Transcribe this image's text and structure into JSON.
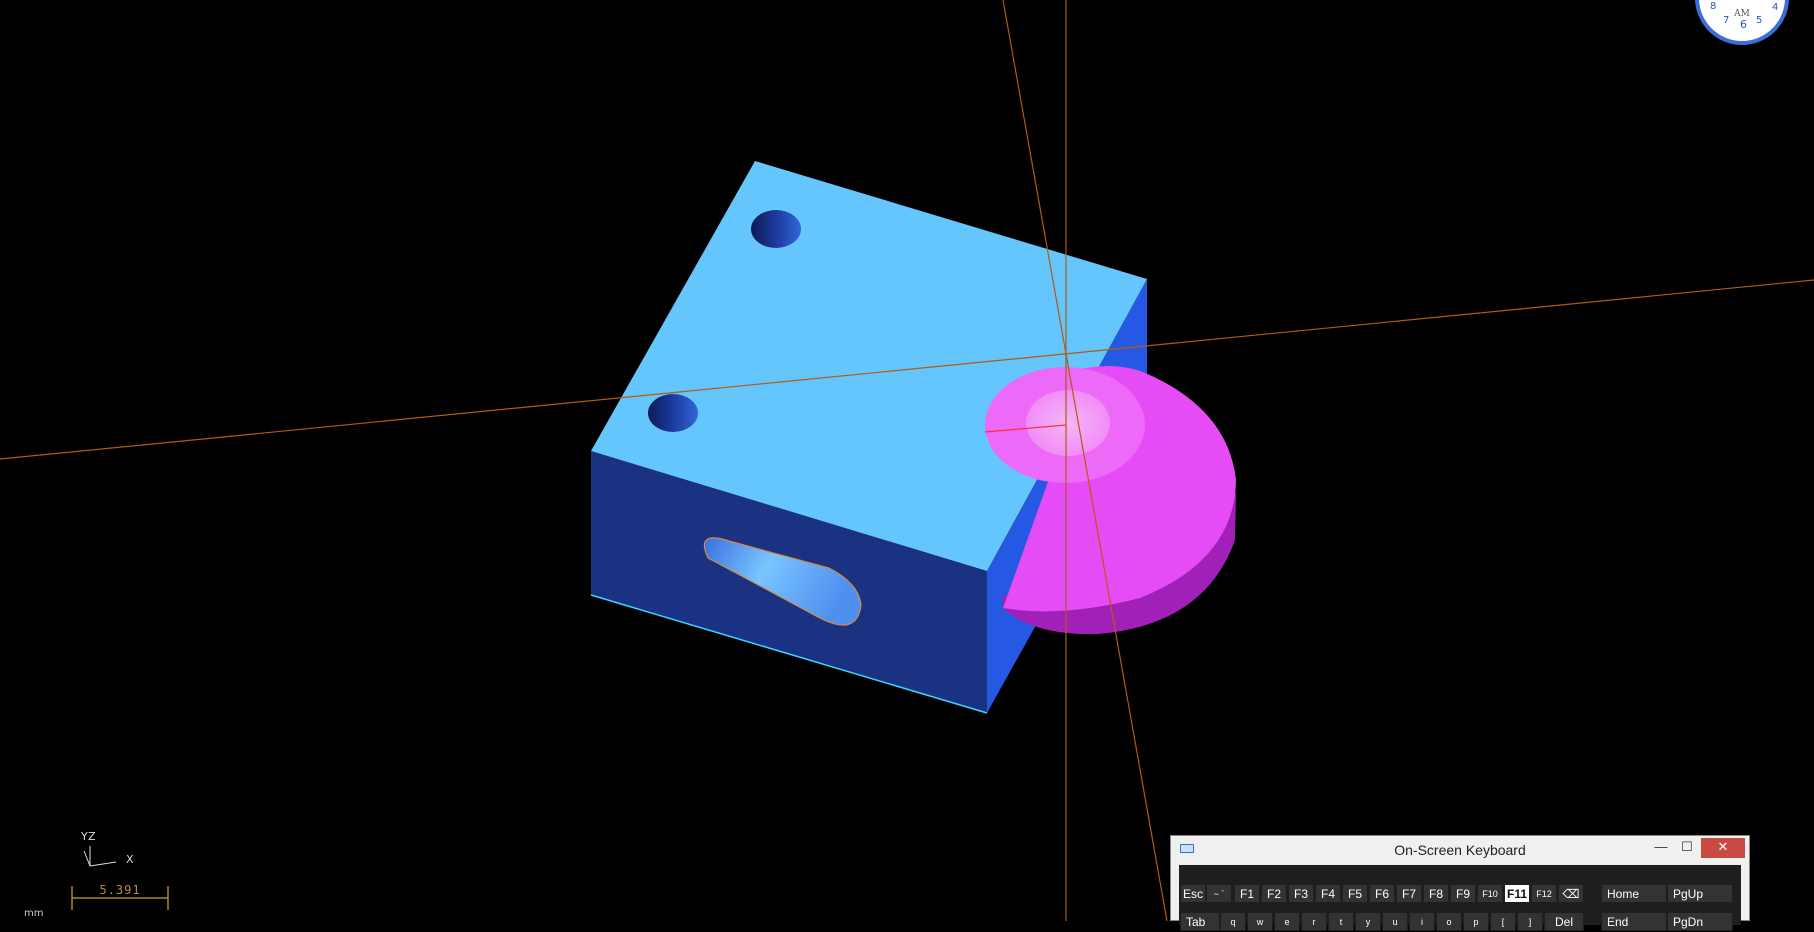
{
  "viewport": {
    "triad": {
      "y": "Y",
      "z": "Z",
      "x": "X"
    },
    "scale_value": "5.391",
    "units": "mm",
    "colors": {
      "background": "#000000",
      "block_top": "#64c6fd",
      "block_front": "#1b3283",
      "block_side": "#2559e4",
      "part_magenta": "#e64cf5",
      "axis_line": "#b35a10"
    }
  },
  "clock": {
    "ampm": "AM",
    "numbers": [
      "8",
      "7",
      "6",
      "5",
      "4"
    ]
  },
  "osk": {
    "title": "On-Screen Keyboard",
    "controls": {
      "minimize": "—",
      "maximize": "☐",
      "close": "✕"
    },
    "row1": [
      "Esc",
      "~ `",
      "F1",
      "F2",
      "F3",
      "F4",
      "F5",
      "F6",
      "F7",
      "F8",
      "F9",
      "F10",
      "F11",
      "F12",
      "⌫",
      "Home",
      "PgUp"
    ],
    "row2": [
      "Tab",
      "q",
      "w",
      "e",
      "r",
      "t",
      "y",
      "u",
      "i",
      "o",
      "p",
      "[",
      "]",
      "Del",
      "End",
      "PgDn"
    ],
    "active_key": "F11"
  }
}
